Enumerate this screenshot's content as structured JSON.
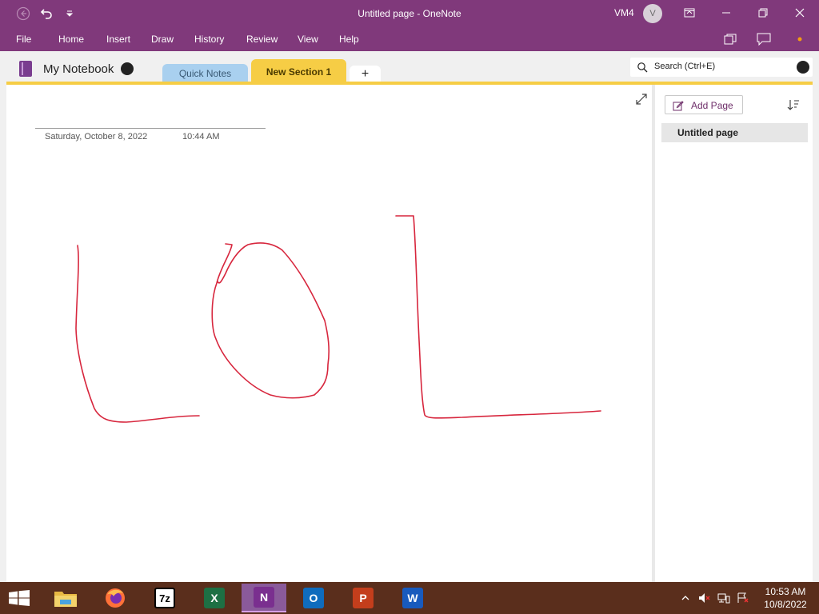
{
  "window": {
    "title": "Untitled page  -  OneNote",
    "user_name": "VM4",
    "avatar_initial": "V"
  },
  "menu": {
    "items": [
      "File",
      "Home",
      "Insert",
      "Draw",
      "History",
      "Review",
      "View",
      "Help"
    ]
  },
  "notebook": {
    "name": "My Notebook",
    "sections": [
      {
        "label": "Quick Notes",
        "color": "#a9d0ef"
      },
      {
        "label": "New Section 1",
        "color": "#f6cd45",
        "active": true
      }
    ],
    "add_section_label": "+"
  },
  "search": {
    "placeholder": "Search (Ctrl+E)"
  },
  "page": {
    "date": "Saturday, October 8, 2022",
    "time": "10:44 AM",
    "ink_color": "#d7263d",
    "ink_content": "LOL handwritten"
  },
  "page_list": {
    "add_page_label": "Add Page",
    "pages": [
      "Untitled page"
    ]
  },
  "taskbar": {
    "apps": [
      {
        "name": "File Explorer",
        "icon": "folder-icon"
      },
      {
        "name": "Firefox",
        "icon": "firefox-icon"
      },
      {
        "name": "7-Zip",
        "label": "7z",
        "icon": "7zip-icon"
      },
      {
        "name": "Excel",
        "label": "X",
        "icon": "excel-icon",
        "color": "#1d7044"
      },
      {
        "name": "OneNote",
        "label": "N",
        "icon": "onenote-icon",
        "color": "#7a2f8f",
        "active": true
      },
      {
        "name": "Outlook",
        "label": "O",
        "icon": "outlook-icon",
        "color": "#0f6cbd"
      },
      {
        "name": "PowerPoint",
        "label": "P",
        "icon": "powerpoint-icon",
        "color": "#c43e1c"
      },
      {
        "name": "Word",
        "label": "W",
        "icon": "word-icon",
        "color": "#185abd"
      }
    ],
    "clock_time": "10:53 AM",
    "clock_date": "10/8/2022"
  }
}
